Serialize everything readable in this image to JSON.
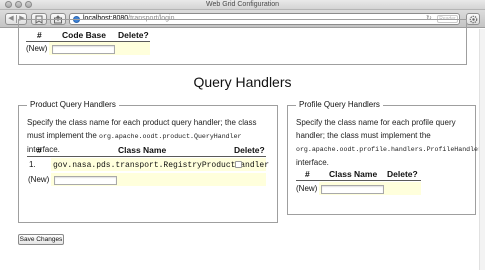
{
  "window": {
    "title": "Web Grid Configuration"
  },
  "toolbar": {
    "back_glyph": "◀",
    "forward_glyph": "▶",
    "url_host": "localhost:8080",
    "url_path": "/transport/login",
    "reader_label": "Reader"
  },
  "code_base_table": {
    "headers": [
      "#",
      "Code Base",
      "Delete?"
    ],
    "new_label": "(New)"
  },
  "section_title": "Query Handlers",
  "product_query_handlers": {
    "legend": "Product Query Handlers",
    "description_before": "Specify the class name for each product query handler; the class must implement the ",
    "interface_name": "org.apache.oodt.product.QueryHandler",
    "description_after": " interface.",
    "headers": [
      "#",
      "Class Name",
      "Delete?"
    ],
    "rows": [
      {
        "number": "1.",
        "class_name": "gov.nasa.pds.transport.RegistryProductHandler",
        "delete": false
      }
    ],
    "new_label": "(New)"
  },
  "profile_query_handlers": {
    "legend": "Profile Query Handlers",
    "description_before": "Specify the class name for each profile query handler; the class must implement the ",
    "interface_name": "org.apache.oodt.profile.handlers.ProfileHandler",
    "description_after": " interface.",
    "headers": [
      "#",
      "Class Name",
      "Delete?"
    ],
    "new_label": "(New)"
  },
  "save_button_label": "Save Changes"
}
